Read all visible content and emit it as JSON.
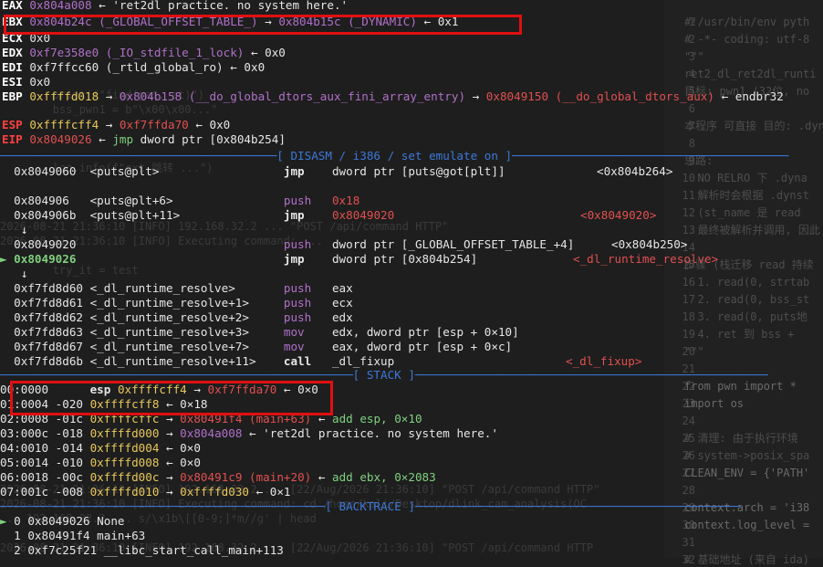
{
  "registers": [
    {
      "name": "EAX",
      "parts": [
        {
          "t": "0x804a008",
          "c": "purple"
        },
        {
          "t": " ← ",
          "c": "white"
        },
        {
          "t": "'ret2dl practice. no system here.'",
          "c": "white"
        }
      ]
    },
    {
      "name": "EBX",
      "parts": [
        {
          "t": "0x804b24c (_GLOBAL_OFFSET_TABLE_)",
          "c": "purple"
        },
        {
          "t": " → ",
          "c": "white"
        },
        {
          "t": "0x804b15c (_DYNAMIC)",
          "c": "purple"
        },
        {
          "t": " ← ",
          "c": "white"
        },
        {
          "t": "0x1",
          "c": "white"
        }
      ]
    },
    {
      "name": "ECX",
      "parts": [
        {
          "t": "0x0",
          "c": "white"
        }
      ]
    },
    {
      "name": "EDX",
      "parts": [
        {
          "t": "0xf7e358e0 (_IO_stdfile_1_lock)",
          "c": "purple"
        },
        {
          "t": " ← ",
          "c": "white"
        },
        {
          "t": "0x0",
          "c": "white"
        }
      ]
    },
    {
      "name": "EDI",
      "parts": [
        {
          "t": "0xf7ffcc60 (_rtld_global_ro)",
          "c": "white"
        },
        {
          "t": " ← ",
          "c": "white"
        },
        {
          "t": "0x0",
          "c": "white"
        }
      ]
    },
    {
      "name": "ESI",
      "parts": [
        {
          "t": "0x0",
          "c": "white"
        }
      ]
    },
    {
      "name": "EBP",
      "parts": [
        {
          "t": "0xffffd018",
          "c": "yellow"
        },
        {
          "t": " → ",
          "c": "white"
        },
        {
          "t": "0x804b158 (__do_global_dtors_aux_fini_array_entry)",
          "c": "purple"
        },
        {
          "t": " → ",
          "c": "white"
        },
        {
          "t": "0x8049150 (__do_global_dtors_aux)",
          "c": "red"
        },
        {
          "t": " ← ",
          "c": "white"
        },
        {
          "t": "endbr32",
          "c": "white"
        }
      ]
    },
    {
      "name": "ESP",
      "parts": [
        {
          "t": "0xffffcff4",
          "c": "yellow"
        },
        {
          "t": " → ",
          "c": "white"
        },
        {
          "t": "0xf7ffda70",
          "c": "red"
        },
        {
          "t": " ← ",
          "c": "white"
        },
        {
          "t": "0x0",
          "c": "white"
        }
      ]
    },
    {
      "name": "EIP",
      "parts": [
        {
          "t": "0x8049026",
          "c": "red"
        },
        {
          "t": " ← ",
          "c": "white"
        },
        {
          "t": "jmp",
          "c": "green"
        },
        {
          "t": " dword ptr [0x804b254]",
          "c": "white"
        }
      ]
    }
  ],
  "disasm_header": "[ DISASM / i386 / set emulate on ]",
  "disasm": [
    {
      "addr": "0x8049060",
      "sym": "<puts@plt>",
      "mn": "jmp",
      "mnc": "jmp",
      "ops": "dword ptr [puts@got[plt]]",
      "tgt": "<0x804b264>",
      "tgtc": "white"
    },
    {
      "blank": true
    },
    {
      "addr": "0x804906",
      "sym": "<puts@plt+6>",
      "mn": "push",
      "mnc": "push",
      "ops": "0x18",
      "opsc": "red"
    },
    {
      "addr": "0x804906b",
      "sym": "<puts@plt+11>",
      "mn": "jmp",
      "mnc": "jmp",
      "ops": "0x8049020",
      "opsc": "red",
      "tgt": "<0x8049020>",
      "tgtc": "red"
    },
    {
      "down": "↓"
    },
    {
      "addr": "0x8049020",
      "sym": "",
      "mn": "push",
      "mnc": "push",
      "ops": "dword ptr [_GLOBAL_OFFSET_TABLE_+4]",
      "tgt": "<0x804b250>",
      "tgtc": "white"
    },
    {
      "addr": "0x8049026",
      "sym": "",
      "mn": "jmp",
      "mnc": "jmp",
      "ops": "dword ptr [0x804b254]",
      "tgt": "<_dl_runtime_resolve>",
      "tgtc": "red",
      "current": true
    },
    {
      "down": "↓"
    },
    {
      "addr": "0xf7fd8d60",
      "sym": "<_dl_runtime_resolve>",
      "mn": "push",
      "mnc": "push",
      "ops": "eax"
    },
    {
      "addr": "0xf7fd8d61",
      "sym": "<_dl_runtime_resolve+1>",
      "mn": "push",
      "mnc": "push",
      "ops": "ecx"
    },
    {
      "addr": "0xf7fd8d62",
      "sym": "<_dl_runtime_resolve+2>",
      "mn": "push",
      "mnc": "push",
      "ops": "edx"
    },
    {
      "addr": "0xf7fd8d63",
      "sym": "<_dl_runtime_resolve+3>",
      "mn": "mov",
      "mnc": "mov",
      "ops": "edx, dword ptr [esp + 0×10]"
    },
    {
      "addr": "0xf7fd8d67",
      "sym": "<_dl_runtime_resolve+7>",
      "mn": "mov",
      "mnc": "mov",
      "ops": "eax, dword ptr [esp + 0×c]"
    },
    {
      "addr": "0xf7fd8d6b",
      "sym": "<_dl_runtime_resolve+11>",
      "mn": "call",
      "mnc": "call",
      "ops": "_dl_fixup",
      "tgt": "<_dl_fixup>",
      "tgtc": "red"
    }
  ],
  "current_marker": "►",
  "stack_header": "[ STACK ]",
  "stack": [
    {
      "idx": "00:0000",
      "off": "",
      "reg": "esp",
      "addr": "0xffffcff4",
      "rest": [
        {
          "t": " → ",
          "c": "white"
        },
        {
          "t": "0xf7ffda70",
          "c": "red"
        },
        {
          "t": " ← ",
          "c": "white"
        },
        {
          "t": "0×0",
          "c": "white"
        }
      ]
    },
    {
      "idx": "01:0004",
      "off": "-020",
      "reg": "",
      "addr": "0xffffcff8",
      "rest": [
        {
          "t": " ← ",
          "c": "white"
        },
        {
          "t": "0×18",
          "c": "white"
        }
      ]
    },
    {
      "idx": "02:0008",
      "off": "-01c",
      "reg": "",
      "addr": "0xffffcffc",
      "rest": [
        {
          "t": " → ",
          "c": "white"
        },
        {
          "t": "0x80491f4 (main+63)",
          "c": "red"
        },
        {
          "t": " ← ",
          "c": "white"
        },
        {
          "t": "add esp, 0×10",
          "c": "green"
        }
      ]
    },
    {
      "idx": "03:000c",
      "off": "-018",
      "reg": "",
      "addr": "0xffffd000",
      "rest": [
        {
          "t": " → ",
          "c": "white"
        },
        {
          "t": "0x804a008",
          "c": "purple"
        },
        {
          "t": " ← ",
          "c": "white"
        },
        {
          "t": "'ret2dl practice. no system here.'",
          "c": "white"
        }
      ]
    },
    {
      "idx": "04:0010",
      "off": "-014",
      "reg": "",
      "addr": "0xffffd004",
      "rest": [
        {
          "t": " ← ",
          "c": "white"
        },
        {
          "t": "0×0",
          "c": "white"
        }
      ]
    },
    {
      "idx": "05:0014",
      "off": "-010",
      "reg": "",
      "addr": "0xffffd008",
      "rest": [
        {
          "t": " ← ",
          "c": "white"
        },
        {
          "t": "0×0",
          "c": "white"
        }
      ]
    },
    {
      "idx": "06:0018",
      "off": "-00c",
      "reg": "",
      "addr": "0xffffd00c",
      "rest": [
        {
          "t": " → ",
          "c": "white"
        },
        {
          "t": "0x80491c9 (main+20)",
          "c": "red"
        },
        {
          "t": " ← ",
          "c": "white"
        },
        {
          "t": "add ebx, 0×2083",
          "c": "green"
        }
      ]
    },
    {
      "idx": "07:001c",
      "off": "-008",
      "reg": "",
      "addr": "0xffffd010",
      "rest": [
        {
          "t": " → ",
          "c": "white"
        },
        {
          "t": "0xffffd030",
          "c": "yellow"
        },
        {
          "t": " ← ",
          "c": "white"
        },
        {
          "t": "0×1",
          "c": "white"
        }
      ]
    }
  ],
  "backtrace_header": "[ BACKTRACE ]",
  "backtrace": [
    {
      "marker": "►",
      "idx": "0",
      "addr": "0x8049026",
      "sym": "None"
    },
    {
      "marker": "",
      "idx": "1",
      "addr": "0x80491f4",
      "sym": "main+63"
    },
    {
      "marker": "",
      "idx": "2",
      "addr": "0xf7c25f21",
      "sym": "__libc_start_call_main+113"
    }
  ],
  "editor_lines": [
    {
      "n": "1",
      "code": "#!/usr/bin/env pyth"
    },
    {
      "n": "2",
      "code": "# -*- coding: utf-8"
    },
    {
      "n": "3",
      "code": "\"\"\""
    },
    {
      "n": "4",
      "code": "ret2_dl_ret2dl_runti"
    },
    {
      "n": "5",
      "code": "目标: pwn1 (32位, no"
    },
    {
      "n": "6",
      "code": ""
    },
    {
      "n": "7",
      "code": "本程序 可直接 目的: .dyna"
    },
    {
      "n": "8",
      "code": ""
    },
    {
      "n": "9",
      "code": "思路:"
    },
    {
      "n": "10",
      "code": "  NO RELRO 下 .dyna"
    },
    {
      "n": "11",
      "code": "  解析时会根据 .dynst"
    },
    {
      "n": "12",
      "code": "  (st_name 是 read"
    },
    {
      "n": "13",
      "code": "  最终被解析并调用, 因此"
    },
    {
      "n": "14",
      "code": ""
    },
    {
      "n": "15",
      "code": "步骤 (栈迁移 read 持续"
    },
    {
      "n": "16",
      "code": "  1. read(0, strtab"
    },
    {
      "n": "17",
      "code": "  2. read(0, bss_st"
    },
    {
      "n": "18",
      "code": "  3. read(0, puts地"
    },
    {
      "n": "19",
      "code": "  4. ret 到 bss + "
    },
    {
      "n": "20",
      "code": "\"\"\""
    },
    {
      "n": "21",
      "code": ""
    },
    {
      "n": "22",
      "code": "from pwn import *"
    },
    {
      "n": "23",
      "code": "import os"
    },
    {
      "n": "24",
      "code": ""
    },
    {
      "n": "25",
      "code": "# 清理: 由于执行环境"
    },
    {
      "n": "26",
      "code": "# system->posix_spa"
    },
    {
      "n": "27",
      "code": "CLEAN_ENV = {'PATH'"
    },
    {
      "n": "28",
      "code": ""
    },
    {
      "n": "29",
      "code": "context.arch = 'i38"
    },
    {
      "n": "30",
      "code": "context.log_level ="
    },
    {
      "n": "31",
      "code": ""
    },
    {
      "n": "32",
      "code": "# 基础地址 (来自 ida)"
    }
  ]
}
